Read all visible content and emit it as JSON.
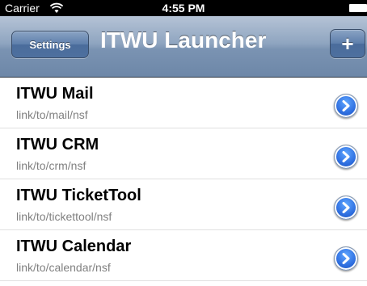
{
  "status_bar": {
    "carrier": "Carrier",
    "time": "4:55 PM",
    "wifi_icon": "wifi-icon",
    "battery_icon": "battery-icon"
  },
  "nav_bar": {
    "settings_label": "Settings",
    "title": "ITWU Launcher",
    "add_label": "+"
  },
  "list": {
    "items": [
      {
        "title": "ITWU Mail",
        "subtitle": "link/to/mail/nsf"
      },
      {
        "title": "ITWU CRM",
        "subtitle": "link/to/crm/nsf"
      },
      {
        "title": "ITWU TicketTool",
        "subtitle": "link/to/tickettool/nsf"
      },
      {
        "title": "ITWU Calendar",
        "subtitle": "link/to/calendar/nsf"
      }
    ]
  },
  "colors": {
    "nav_bar": "#7a93b2",
    "disclosure": "#2f6fe0",
    "subtitle": "#808080"
  }
}
